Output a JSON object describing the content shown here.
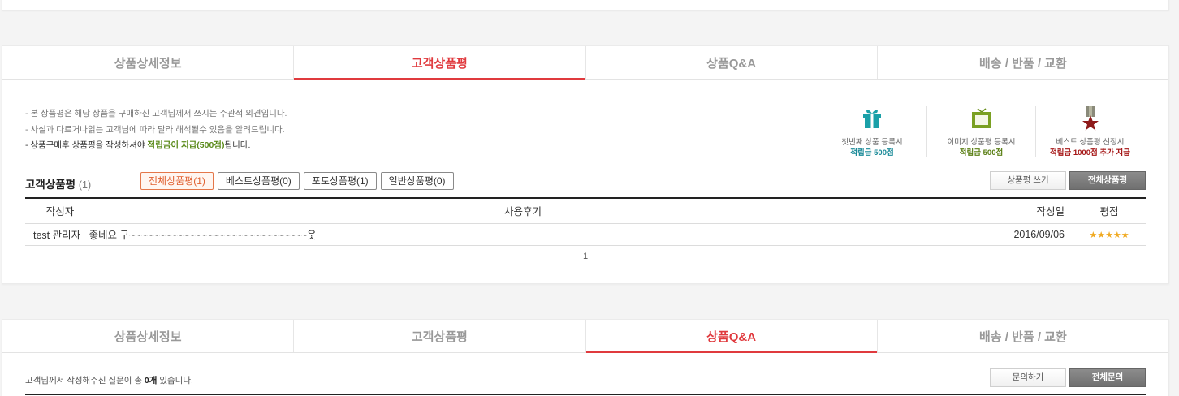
{
  "review_section": {
    "tabs": [
      "상품상세정보",
      "고객상품평",
      "상품Q&A",
      "배송 / 반품 / 교환"
    ],
    "notice": {
      "line1": "- 본 상품평은 해당 상품을 구매하신 고객님께서 쓰시는 주관적 의견입니다.",
      "line2": "- 사실과 다르거나읽는 고객님에 따라 달라 해석될수 있음을 알려드립니다.",
      "line3_prefix": "- 상품구매후 상품평을 작성하셔야 ",
      "line3_highlight": "적립금이 지급(500점)",
      "line3_suffix": "됩니다."
    },
    "perks": [
      {
        "icon": "gift-icon",
        "label": "첫번째 상품 등록시",
        "reward": "적립금 500점",
        "color": "#1aa0a8"
      },
      {
        "icon": "picture-frame-icon",
        "label": "이미지 상품평 등록시",
        "reward": "적립금 500점",
        "color": "#6a8f1c"
      },
      {
        "icon": "medal-star-icon",
        "label": "베스트 상품평 선정시",
        "reward": "적립금 1000점 추가 지급",
        "color": "#b01c1c"
      }
    ],
    "list_title": "고객상품평",
    "list_count": "(1)",
    "filters": [
      "전체상품평(1)",
      "베스트상품평(0)",
      "포토상품평(1)",
      "일반상품평(0)"
    ],
    "write_button": "상품평 쓰기",
    "all_button": "전체상품평",
    "table": {
      "headers": [
        "작성자",
        "사용후기",
        "작성일",
        "평점"
      ],
      "rows": [
        {
          "author": "test 관리자",
          "review": "좋네요 구~~~~~~~~~~~~~~~~~~~~~~~~~~~~~~웃",
          "date": "2016/09/06",
          "stars": "★★★★★"
        }
      ]
    },
    "pager": "1"
  },
  "qna_section": {
    "tabs": [
      "상품상세정보",
      "고객상품평",
      "상품Q&A",
      "배송 / 반품 / 교환"
    ],
    "notice_prefix": "고객님께서 작성해주신 질문이 총 ",
    "notice_count": "0개",
    "notice_suffix": " 있습니다.",
    "ask_button": "문의하기",
    "all_button": "전체문의"
  },
  "colors": {
    "accent": "#e03a3e",
    "star": "#f0a920"
  }
}
